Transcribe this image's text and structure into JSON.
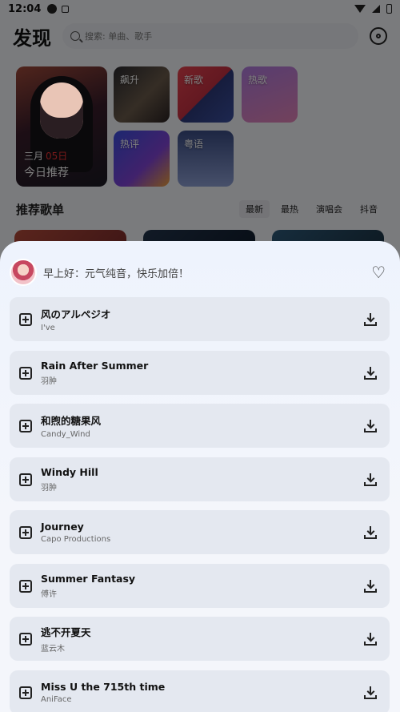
{
  "status": {
    "time": "12:04"
  },
  "header": {
    "title": "发现",
    "search_placeholder": "搜索: 单曲、歌手"
  },
  "featured": {
    "date_month": "三月",
    "date_day": "05日",
    "title": "今日推荐",
    "tiles": [
      "飙升",
      "新歌",
      "热歌",
      "热评",
      "粤语"
    ]
  },
  "playlist_section": {
    "heading": "推荐歌单",
    "tabs": [
      "最新",
      "最热",
      "演唱会",
      "抖音"
    ]
  },
  "sheet": {
    "greeting": "早上好：元气纯音，快乐加倍！",
    "songs": [
      {
        "name": "风のアルペジオ",
        "artist": "I've"
      },
      {
        "name": "Rain After Summer",
        "artist": "羽肿"
      },
      {
        "name": "和煦的糖果风",
        "artist": "Candy_Wind"
      },
      {
        "name": "Windy Hill",
        "artist": "羽肿"
      },
      {
        "name": "Journey",
        "artist": "Capo Productions"
      },
      {
        "name": "Summer Fantasy",
        "artist": "傅许"
      },
      {
        "name": "逃不开夏天",
        "artist": "蓝云木"
      },
      {
        "name": "Miss U the 715th time",
        "artist": "AniFace"
      }
    ]
  }
}
